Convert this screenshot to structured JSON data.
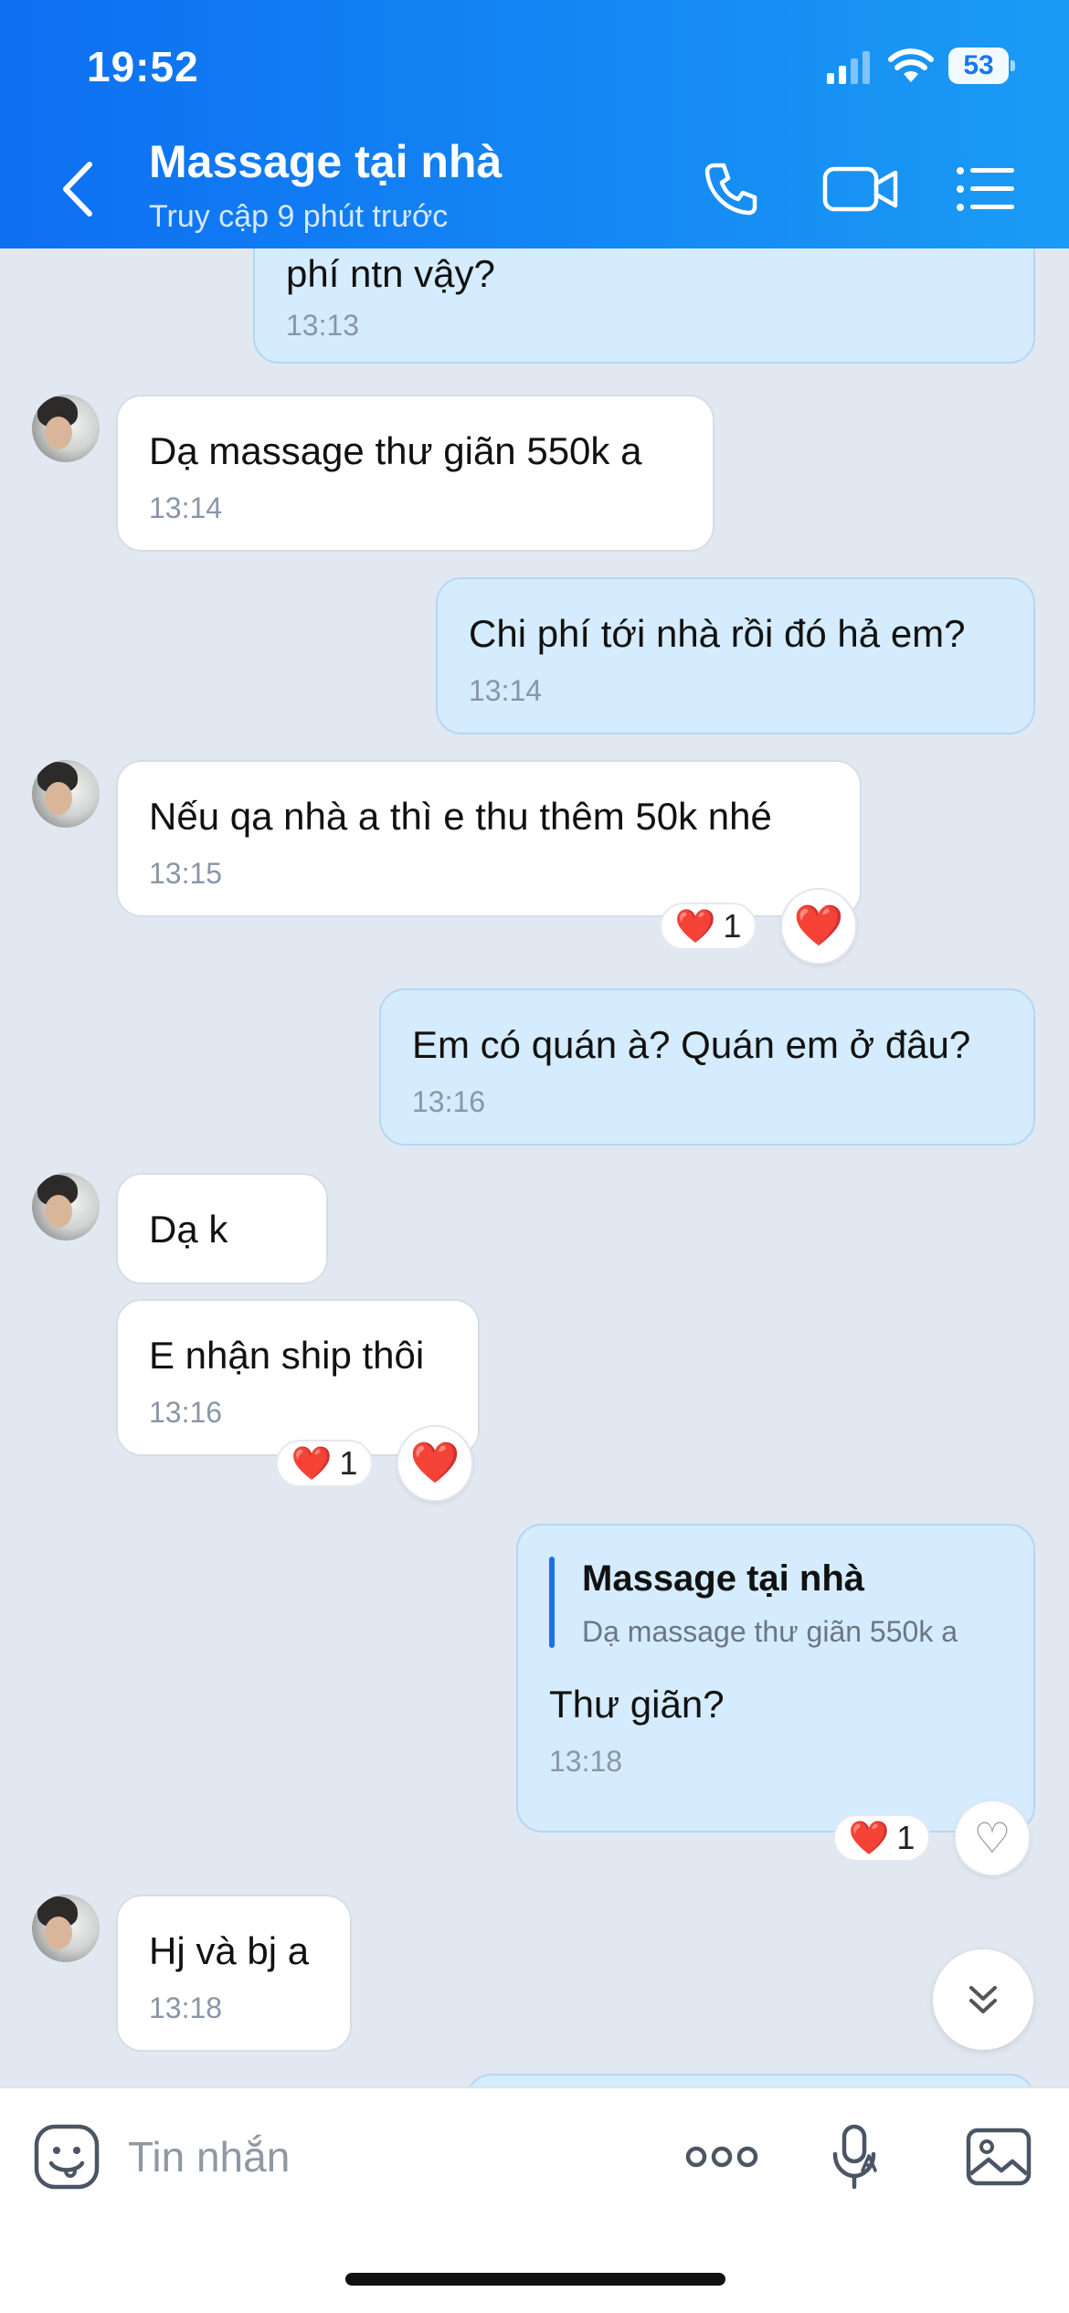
{
  "status_bar": {
    "time": "19:52",
    "battery": "53"
  },
  "header": {
    "title": "Massage tại nhà",
    "subtitle": "Truy cập 9 phút trước"
  },
  "messages": [
    {
      "dir": "out",
      "text": "phí ntn vậy?",
      "time": "13:13"
    },
    {
      "dir": "in",
      "text": "Dạ massage thư giãn 550k a",
      "time": "13:14"
    },
    {
      "dir": "out",
      "text": "Chi phí tới nhà rồi đó hả em?",
      "time": "13:14"
    },
    {
      "dir": "in",
      "text": "Nếu qa nhà a thì e thu thêm 50k nhé",
      "time": "13:15",
      "reaction_count": "1"
    },
    {
      "dir": "out",
      "text": "Em có quán à? Quán em ở đâu?",
      "time": "13:16"
    },
    {
      "dir": "in",
      "text": "Dạ k"
    },
    {
      "dir": "in",
      "text": "E nhận ship thôi",
      "time": "13:16",
      "reaction_count": "1"
    },
    {
      "dir": "out",
      "quote_title": "Massage tại nhà",
      "quote_text": "Dạ massage thư giãn 550k a",
      "text": "Thư giãn?",
      "time": "13:18",
      "reaction_count": "1"
    },
    {
      "dir": "in",
      "text": "Hj và bj a",
      "time": "13:18"
    }
  ],
  "reaction_emoji": "❤️",
  "input": {
    "placeholder": "Tin nhắn"
  },
  "colors": {
    "header_start": "#0d6ff2",
    "header_end": "#1a9bf5",
    "outgoing_bubble": "#d4ecfd",
    "incoming_bubble": "#ffffff",
    "chat_bg": "#e2e8f1",
    "heart": "#e8182f"
  },
  "icons": [
    "back-icon",
    "phone-icon",
    "video-icon",
    "menu-icon",
    "chevron-double-down-icon",
    "sticker-icon",
    "more-icon",
    "voice-icon",
    "image-icon",
    "heart-icon"
  ]
}
